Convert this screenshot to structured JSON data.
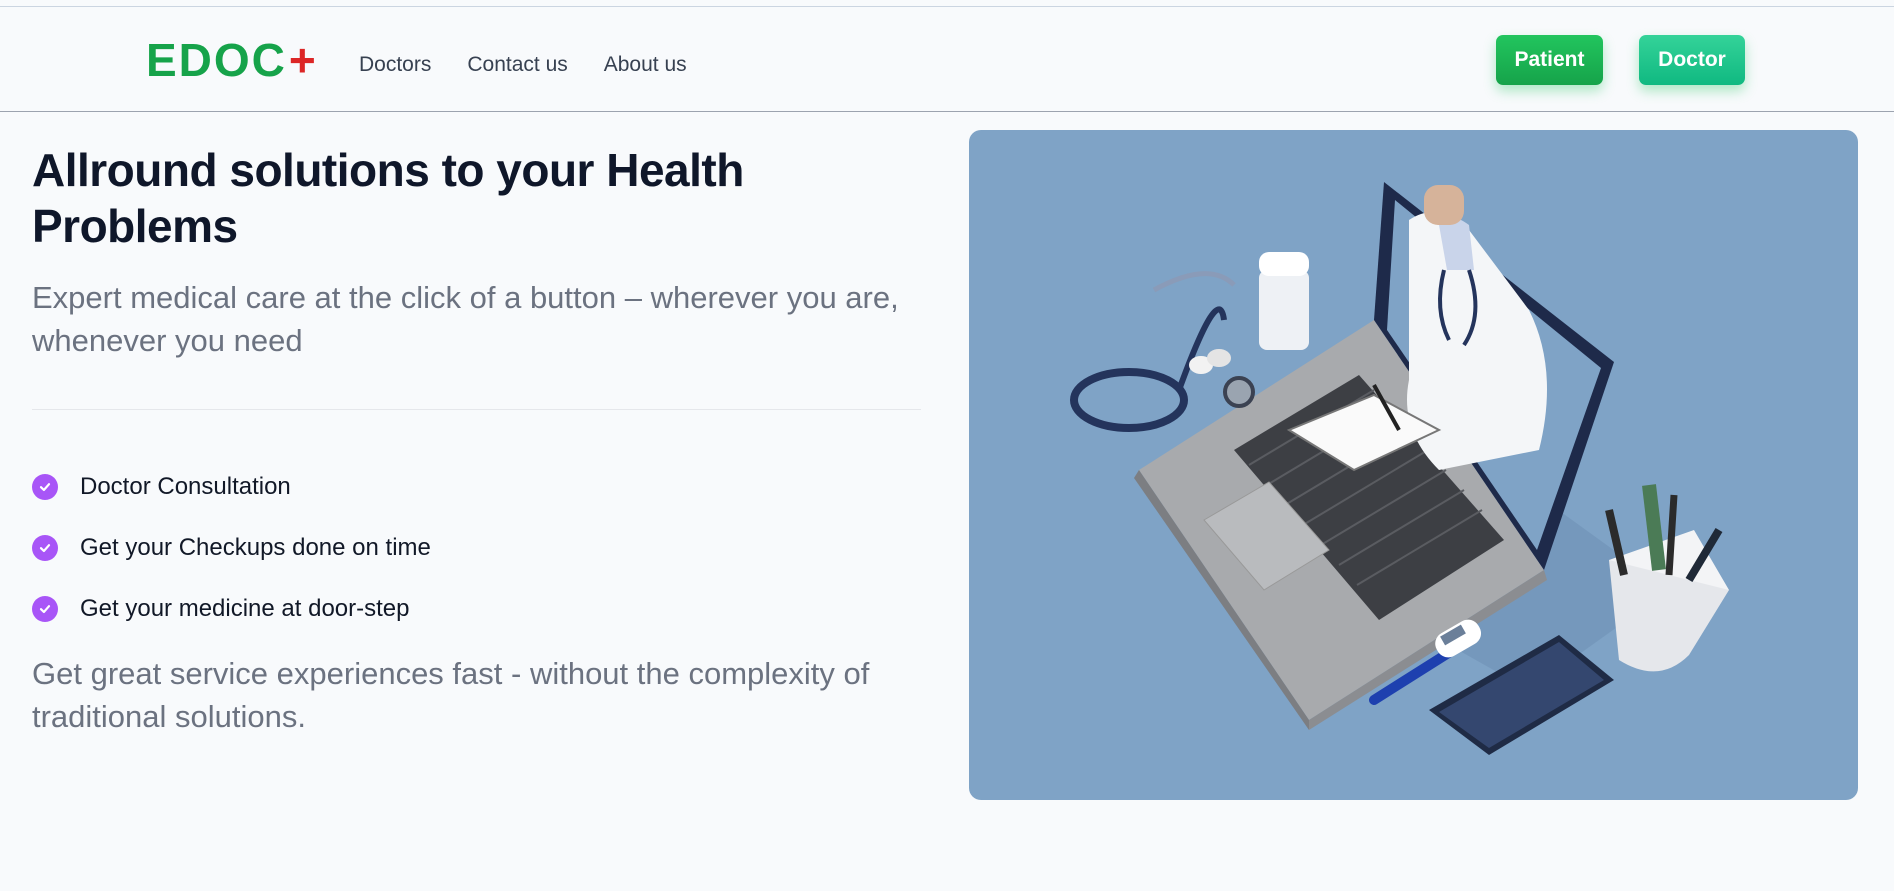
{
  "brand": {
    "name": "EDOC",
    "mark": "+",
    "primary_color": "#16a34a",
    "mark_color": "#dc2626"
  },
  "nav": {
    "links": [
      "Doctors",
      "Contact us",
      "About us"
    ]
  },
  "actions": {
    "patient_label": "Patient",
    "doctor_label": "Doctor"
  },
  "hero": {
    "title": "Allround solutions to your Health Problems",
    "subtitle": "Expert medical care at the click of a button – wherever you are, whenever you need",
    "features": [
      {
        "label": "Doctor Consultation",
        "icon": "check-circle-icon"
      },
      {
        "label": "Get your Checkups done on time",
        "icon": "check-circle-icon"
      },
      {
        "label": "Get your medicine at door-step",
        "icon": "check-circle-icon"
      }
    ],
    "note": "Get great service experiences fast - without the complexity of traditional solutions.",
    "accent_color": "#a855f7",
    "image_background": "#7fa3c6"
  }
}
